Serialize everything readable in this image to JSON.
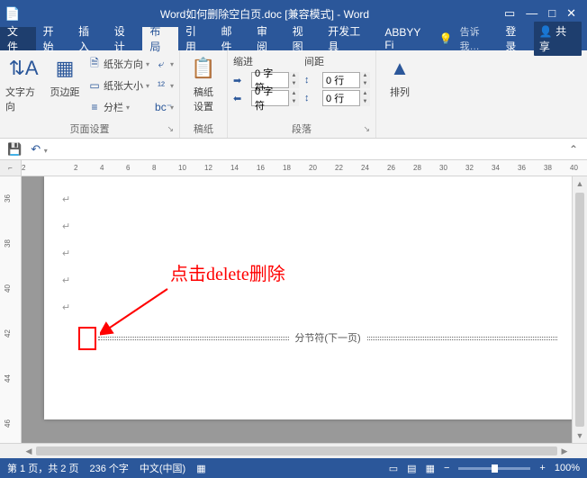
{
  "title_bar": {
    "title": "Word如何删除空白页.doc [兼容模式] - Word"
  },
  "tabs": {
    "file": "文件",
    "items": [
      "开始",
      "插入",
      "设计",
      "布局",
      "引用",
      "邮件",
      "审阅",
      "视图",
      "开发工具",
      "ABBYY Fi"
    ],
    "active_index": 3,
    "tell_me": "告诉我…",
    "login": "登录",
    "share": "共享"
  },
  "ribbon": {
    "page_setup": {
      "text_direction": "文字方向",
      "margins": "页边距",
      "orientation": "纸张方向",
      "size": "纸张大小",
      "columns": "分栏",
      "group_label": "页面设置"
    },
    "breaks_group": {
      "label": ""
    },
    "manuscript": {
      "btn": "稿纸\n设置",
      "group_label": "稿纸"
    },
    "paragraph": {
      "indent_label": "缩进",
      "spacing_label": "间距",
      "indent_left": "0 字符",
      "indent_right": "0 字符",
      "space_before": "0 行",
      "space_after": "0 行",
      "group_label": "段落"
    },
    "arrange": {
      "btn": "排列",
      "group_label": ""
    }
  },
  "document": {
    "section_break": "分节符(下一页)",
    "annotation": "点击delete删除"
  },
  "ruler_h": [
    "2",
    "",
    "2",
    "4",
    "6",
    "8",
    "10",
    "12",
    "14",
    "16",
    "18",
    "20",
    "22",
    "24",
    "26",
    "28",
    "30",
    "32",
    "34",
    "36",
    "38",
    "40"
  ],
  "ruler_v": [
    "36",
    "38",
    "40",
    "42",
    "44",
    "46"
  ],
  "status": {
    "page": "第 1 页，共 2 页",
    "words": "236 个字",
    "lang": "中文(中国)",
    "zoom": "100%"
  }
}
